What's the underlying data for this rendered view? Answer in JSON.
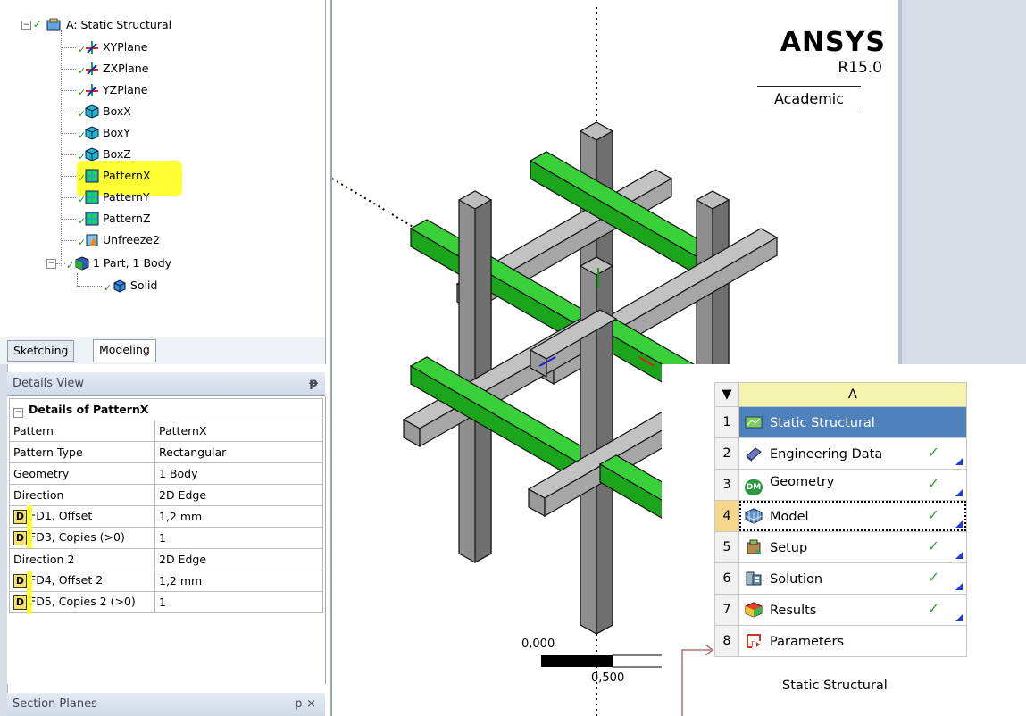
{
  "tree": {
    "root": "A: Static Structural",
    "items": [
      "XYPlane",
      "ZXPlane",
      "YZPlane",
      "BoxX",
      "BoxY",
      "BoxZ",
      "PatternX",
      "PatternY",
      "PatternZ",
      "Unfreeze2",
      "1 Part, 1 Body"
    ],
    "child": "Solid"
  },
  "tabs": [
    "Sketching",
    "Modeling"
  ],
  "details": {
    "panel_title": "Details View",
    "pin": "ᵽ",
    "group": "Details of PatternX",
    "rows": [
      {
        "name": "Pattern",
        "value": "PatternX",
        "badge": ""
      },
      {
        "name": "Pattern Type",
        "value": "Rectangular",
        "badge": ""
      },
      {
        "name": "Geometry",
        "value": "1 Body",
        "badge": ""
      },
      {
        "name": "Direction",
        "value": "2D Edge",
        "badge": ""
      },
      {
        "name": "FD1, Offset",
        "value": "1,2 mm",
        "badge": "D"
      },
      {
        "name": "FD3, Copies (>0)",
        "value": "1",
        "badge": "D"
      },
      {
        "name": "Direction 2",
        "value": "2D Edge",
        "badge": ""
      },
      {
        "name": "FD4, Offset 2",
        "value": "1,2 mm",
        "badge": "D"
      },
      {
        "name": "FD5, Copies 2 (>0)",
        "value": "1",
        "badge": "D"
      }
    ]
  },
  "section_planes": {
    "title": "Section Planes",
    "controls": "ᵽ ×"
  },
  "logo": {
    "brand": "ANSYS",
    "version": "R15.0",
    "edition": "Academic"
  },
  "scale": {
    "start": "0,000",
    "mid": "0,500"
  },
  "workbench": {
    "column": "A",
    "menu_glyph": "▼",
    "rows": [
      {
        "n": "1",
        "label": "Static Structural",
        "tick": ""
      },
      {
        "n": "2",
        "label": "Engineering Data",
        "tick": "✓"
      },
      {
        "n": "3",
        "label": "Geometry",
        "tick": "✓"
      },
      {
        "n": "4",
        "label": "Model",
        "tick": "✓"
      },
      {
        "n": "5",
        "label": "Setup",
        "tick": "✓"
      },
      {
        "n": "6",
        "label": "Solution",
        "tick": "✓"
      },
      {
        "n": "7",
        "label": "Results",
        "tick": "✓"
      },
      {
        "n": "8",
        "label": "Parameters",
        "tick": ""
      }
    ],
    "caption": "Static Structural",
    "dm_icon_text": "DM"
  },
  "colors": {
    "highlight": "#ffff33",
    "green": "#22b322",
    "grey": "#a3a3a3",
    "selected": "#4f81bd"
  }
}
